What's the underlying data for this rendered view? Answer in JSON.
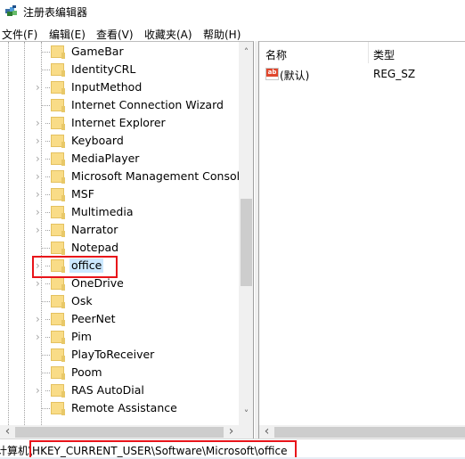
{
  "window": {
    "title": "注册表编辑器",
    "app_icon": "regedit-icon"
  },
  "menu": [
    {
      "label": "文件(F)"
    },
    {
      "label": "编辑(E)"
    },
    {
      "label": "查看(V)"
    },
    {
      "label": "收藏夹(A)"
    },
    {
      "label": "帮助(H)"
    }
  ],
  "tree": {
    "items": [
      {
        "label": "GameBar",
        "expandable": false,
        "selected": false
      },
      {
        "label": "IdentityCRL",
        "expandable": false,
        "selected": false
      },
      {
        "label": "InputMethod",
        "expandable": true,
        "selected": false
      },
      {
        "label": "Internet Connection Wizard",
        "expandable": false,
        "selected": false
      },
      {
        "label": "Internet Explorer",
        "expandable": true,
        "selected": false
      },
      {
        "label": "Keyboard",
        "expandable": true,
        "selected": false
      },
      {
        "label": "MediaPlayer",
        "expandable": true,
        "selected": false
      },
      {
        "label": "Microsoft Management Console",
        "expandable": true,
        "selected": false
      },
      {
        "label": "MSF",
        "expandable": true,
        "selected": false
      },
      {
        "label": "Multimedia",
        "expandable": true,
        "selected": false
      },
      {
        "label": "Narrator",
        "expandable": true,
        "selected": false
      },
      {
        "label": "Notepad",
        "expandable": false,
        "selected": false
      },
      {
        "label": "office",
        "expandable": true,
        "selected": true
      },
      {
        "label": "OneDrive",
        "expandable": true,
        "selected": false
      },
      {
        "label": "Osk",
        "expandable": false,
        "selected": false
      },
      {
        "label": "PeerNet",
        "expandable": true,
        "selected": false
      },
      {
        "label": "Pim",
        "expandable": true,
        "selected": false
      },
      {
        "label": "PlayToReceiver",
        "expandable": false,
        "selected": false
      },
      {
        "label": "Poom",
        "expandable": false,
        "selected": false
      },
      {
        "label": "RAS AutoDial",
        "expandable": true,
        "selected": false
      },
      {
        "label": "Remote Assistance",
        "expandable": false,
        "selected": false
      }
    ],
    "expander_glyph": "›",
    "scroll_up": "˄",
    "scroll_down": "˅",
    "scroll_left": "‹",
    "scroll_right": "›"
  },
  "list": {
    "columns": [
      {
        "label": "名称"
      },
      {
        "label": "类型"
      }
    ],
    "rows": [
      {
        "icon": "string-value-icon",
        "icon_text": "ab",
        "name": "(默认)",
        "type": "REG_SZ"
      }
    ],
    "scroll_left": "‹"
  },
  "statusbar": {
    "path_prefix": "计算机",
    "path": "\\HKEY_CURRENT_USER\\Software\\Microsoft\\office"
  },
  "colors": {
    "highlight": "#e8141a",
    "selection": "#cce8ff",
    "folder": "#f9dc87"
  }
}
